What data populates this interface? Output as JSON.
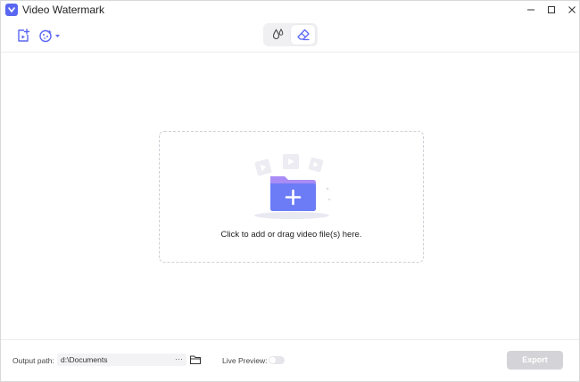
{
  "window": {
    "title": "Video Watermark"
  },
  "colors": {
    "accent": "#5a67f2",
    "folder_top": "#a98cf5",
    "folder_body": "#6b7cf6"
  },
  "toolbar": {
    "add_icon": "add-file-icon",
    "tools_icon": "magic-dropdown-icon",
    "modes": [
      {
        "icon": "watermark-drop-icon"
      },
      {
        "icon": "eraser-icon"
      }
    ]
  },
  "dropzone": {
    "text": "Click to add or drag video file(s) here."
  },
  "bottom": {
    "output_label": "Output path:",
    "output_value": "d:\\Documents",
    "more_label": "···",
    "live_preview_label": "Live Preview:",
    "live_preview_on": false,
    "export_label": "Export"
  }
}
